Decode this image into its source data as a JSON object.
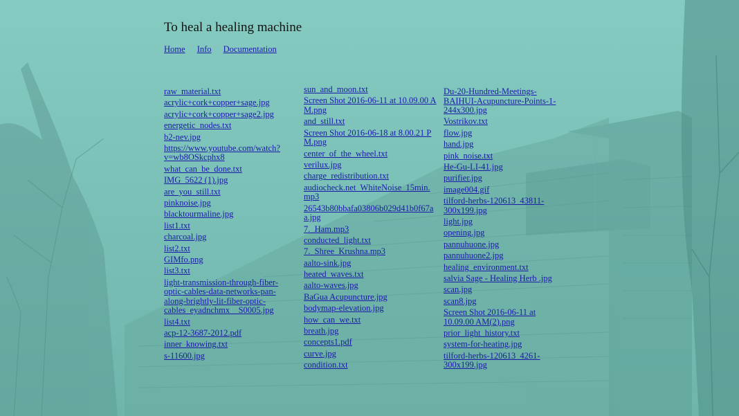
{
  "site": {
    "title": "To heal a healing machine"
  },
  "nav": {
    "items": [
      "Home",
      "Info",
      "Documentation"
    ]
  },
  "files": {
    "column1": [
      "raw_material.txt",
      "acrylic+cork+copper+sage.jpg",
      "acrylic+cork+copper+sage2.jpg",
      "energetic_nodes.txt",
      "b2-nev.jpg",
      "https://www.youtube.com/watch?v=wb8OSkcphx8",
      "what_can_be_done.txt",
      "IMG_5622 (1).jpg",
      "are_you_still.txt",
      "pinknoise.jpg",
      "blacktourmaline.jpg",
      "list1.txt",
      "charcoal.jpg",
      "list2.txt",
      "GIMfo.png",
      "list3.txt",
      "light-transmission-through-fiber-optic-cables-data-networks-pan-along-brightly-lit-fiber-optic-cables_eyadnchmx__S0005.jpg",
      "list4.txt",
      "acp-12-3687-2012.pdf",
      "inner_knowing.txt",
      "s-11600.jpg"
    ],
    "column2": [
      "sun_and_moon.txt",
      "Screen Shot 2016-06-11 at 10.09.00 AM.png",
      "and_still.txt",
      "Screen Shot 2016-06-18 at 8.00.21 PM.png",
      "center_of_the_wheel.txt",
      "verilux.jpg",
      "charge_redistribution.txt",
      "audiocheck.net_WhiteNoise_15min.mp3",
      "26543b80bbafa03806b029d41b0f67aa.jpg",
      "7._Ham.mp3",
      "conducted_light.txt",
      "7._Shree_Krushna.mp3",
      "aalto-sink.jpg",
      "heated_waves.txt",
      "aalto-waves.jpg",
      "BaGua Acupuncture.jpg",
      "bodymap-elevation.jpg",
      "how_can_we.txt",
      "breath.jpg",
      "concepts1.pdf",
      "curve.jpg",
      "condition.txt"
    ],
    "column3": [
      "Du-20-Hundred-Meetings-BAIHUI-Acupuncture-Points-1-244x300.jpg",
      "Vostrikov.txt",
      "flow.jpg",
      "hand.jpg",
      "pink_noise.txt",
      "He-Gu-LI-41.jpg",
      "purifier.jpg",
      "image004.gif",
      "tilford-herbs-120613_43811-300x199.jpg",
      "light.jpg",
      "opening.jpg",
      "pannuhuone.jpg",
      "pannuhuone2.jpg",
      "healing_environment.txt",
      "salvia Sage - Healing Herb .jpg",
      "scan.jpg",
      "scan8.jpg",
      "Screen Shot 2016-06-11 at 10.09.00 AM(2).png",
      "prior_light_history.txt",
      "system-for-heating.jpg",
      "tilford-herbs-120613_4261-300x199.jpg"
    ]
  },
  "colors": {
    "background_tint": "#7fc6bc",
    "link": "#1a1aa8",
    "title": "#111111"
  }
}
